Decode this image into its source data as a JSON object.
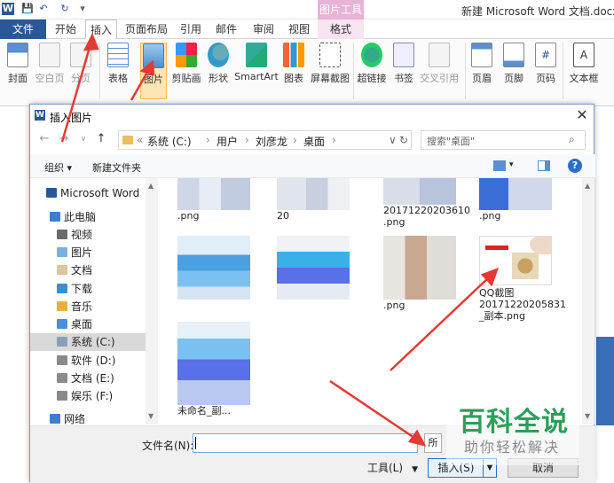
{
  "window": {
    "doc_title": "新建 Microsoft Word 文档.docx -",
    "context_group": "图片工具"
  },
  "tabs": {
    "file": "文件",
    "home": "开始",
    "insert": "插入",
    "layout": "页面布局",
    "references": "引用",
    "mailings": "邮件",
    "review": "审阅",
    "view": "视图",
    "format": "格式"
  },
  "ribbon": {
    "cover": "封面",
    "blank": "空白页",
    "pagebreak": "分页",
    "table": "表格",
    "picture": "图片",
    "clipart": "剪贴画",
    "shapes": "形状",
    "smartart": "SmartArt",
    "chart": "图表",
    "screenshot": "屏幕截图",
    "hyperlink": "超链接",
    "bookmark": "书签",
    "crossref": "交叉引用",
    "header": "页眉",
    "footer": "页脚",
    "pagenum": "页码",
    "textbox": "文本框",
    "colors": {
      "accent": "#2b579a",
      "context": "#e8b3d6"
    }
  },
  "dialog": {
    "title": "插入图片",
    "path": [
      "系统 (C:)",
      "用户",
      "刘彦龙",
      "桌面"
    ],
    "search_placeholder": "搜索\"桌面\"",
    "organize": "组织 ▾",
    "new_folder": "新建文件夹",
    "nav": [
      {
        "label": "Microsoft Word",
        "icon": "word-doc-icon"
      },
      {
        "label": "此电脑",
        "icon": "computer-icon"
      },
      {
        "label": "视频",
        "icon": "video-folder-icon"
      },
      {
        "label": "图片",
        "icon": "pictures-folder-icon"
      },
      {
        "label": "文档",
        "icon": "documents-folder-icon"
      },
      {
        "label": "下载",
        "icon": "downloads-folder-icon"
      },
      {
        "label": "音乐",
        "icon": "music-folder-icon"
      },
      {
        "label": "桌面",
        "icon": "desktop-folder-icon"
      },
      {
        "label": "系统 (C:)",
        "icon": "drive-icon"
      },
      {
        "label": "软件 (D:)",
        "icon": "drive-icon"
      },
      {
        "label": "文档 (E:)",
        "icon": "drive-icon"
      },
      {
        "label": "娱乐 (F:)",
        "icon": "drive-icon"
      },
      {
        "label": "网络",
        "icon": "network-icon"
      }
    ],
    "files_row1": [
      ".png",
      "20",
      "20171220203610\n.png",
      ".png"
    ],
    "files_row2": [
      "",
      "",
      ".png",
      "QQ截图\n20171220205831\n_副本.png"
    ],
    "files_row3": [
      "未命名_副..."
    ],
    "filename_label": "文件名(N):",
    "filename_value": "",
    "filter_label": "所",
    "tools": "工具(L)",
    "insert": "插入(S)",
    "cancel": "取消"
  },
  "watermark": {
    "main": "百科全说",
    "sub": "助你轻松解决"
  }
}
